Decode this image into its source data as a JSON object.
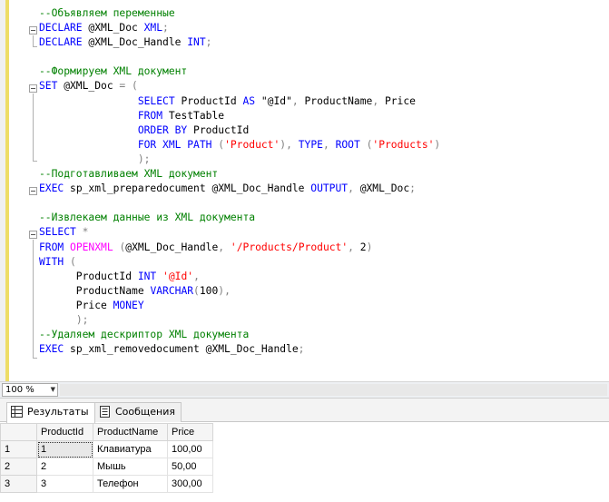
{
  "editor": {
    "lines": [
      [
        {
          "t": "--Объявляем переменные",
          "c": "cm"
        }
      ],
      [
        {
          "t": "DECLARE",
          "c": "kw"
        },
        {
          "t": " @XML_Doc "
        },
        {
          "t": "XML",
          "c": "kw"
        },
        {
          "t": ";",
          "c": "gr"
        }
      ],
      [
        {
          "t": "DECLARE",
          "c": "kw"
        },
        {
          "t": " @XML_Doc_Handle "
        },
        {
          "t": "INT",
          "c": "kw"
        },
        {
          "t": ";",
          "c": "gr"
        }
      ],
      [],
      [
        {
          "t": "--Формируем XML документ",
          "c": "cm"
        }
      ],
      [
        {
          "t": "SET",
          "c": "kw"
        },
        {
          "t": " @XML_Doc "
        },
        {
          "t": "=",
          "c": "gr"
        },
        {
          "t": " "
        },
        {
          "t": "(",
          "c": "gr"
        }
      ],
      [
        {
          "t": "                "
        },
        {
          "t": "SELECT",
          "c": "kw"
        },
        {
          "t": " ProductId "
        },
        {
          "t": "AS",
          "c": "kw"
        },
        {
          "t": " \"@Id\""
        },
        {
          "t": ",",
          "c": "gr"
        },
        {
          "t": " ProductName"
        },
        {
          "t": ",",
          "c": "gr"
        },
        {
          "t": " Price"
        }
      ],
      [
        {
          "t": "                "
        },
        {
          "t": "FROM",
          "c": "kw"
        },
        {
          "t": " TestTable"
        }
      ],
      [
        {
          "t": "                "
        },
        {
          "t": "ORDER BY",
          "c": "kw"
        },
        {
          "t": " ProductId"
        }
      ],
      [
        {
          "t": "                "
        },
        {
          "t": "FOR XML PATH",
          "c": "kw"
        },
        {
          "t": " "
        },
        {
          "t": "(",
          "c": "gr"
        },
        {
          "t": "'Product'",
          "c": "st"
        },
        {
          "t": "),",
          "c": "gr"
        },
        {
          "t": " "
        },
        {
          "t": "TYPE",
          "c": "kw"
        },
        {
          "t": ",",
          "c": "gr"
        },
        {
          "t": " "
        },
        {
          "t": "ROOT",
          "c": "kw"
        },
        {
          "t": " "
        },
        {
          "t": "(",
          "c": "gr"
        },
        {
          "t": "'Products'",
          "c": "st"
        },
        {
          "t": ")",
          "c": "gr"
        }
      ],
      [
        {
          "t": "                "
        },
        {
          "t": ");",
          "c": "gr"
        }
      ],
      [
        {
          "t": "--Подготавливаем XML документ",
          "c": "cm"
        }
      ],
      [
        {
          "t": "EXEC",
          "c": "kw"
        },
        {
          "t": " sp_xml_preparedocument @XML_Doc_Handle "
        },
        {
          "t": "OUTPUT",
          "c": "kw"
        },
        {
          "t": ",",
          "c": "gr"
        },
        {
          "t": " @XML_Doc"
        },
        {
          "t": ";",
          "c": "gr"
        }
      ],
      [],
      [
        {
          "t": "--Извлекаем данные из XML документа",
          "c": "cm"
        }
      ],
      [
        {
          "t": "SELECT",
          "c": "kw"
        },
        {
          "t": " "
        },
        {
          "t": "*",
          "c": "gr"
        }
      ],
      [
        {
          "t": "FROM",
          "c": "kw"
        },
        {
          "t": " "
        },
        {
          "t": "OPENXML",
          "c": "pi"
        },
        {
          "t": " "
        },
        {
          "t": "(",
          "c": "gr"
        },
        {
          "t": "@XML_Doc_Handle"
        },
        {
          "t": ",",
          "c": "gr"
        },
        {
          "t": " "
        },
        {
          "t": "'/Products/Product'",
          "c": "st"
        },
        {
          "t": ",",
          "c": "gr"
        },
        {
          "t": " 2"
        },
        {
          "t": ")",
          "c": "gr"
        }
      ],
      [
        {
          "t": "WITH",
          "c": "kw"
        },
        {
          "t": " "
        },
        {
          "t": "(",
          "c": "gr"
        }
      ],
      [
        {
          "t": "      ProductId "
        },
        {
          "t": "INT",
          "c": "kw"
        },
        {
          "t": " "
        },
        {
          "t": "'@Id'",
          "c": "st"
        },
        {
          "t": ",",
          "c": "gr"
        }
      ],
      [
        {
          "t": "      ProductName "
        },
        {
          "t": "VARCHAR",
          "c": "kw"
        },
        {
          "t": "(",
          "c": "gr"
        },
        {
          "t": "100"
        },
        {
          "t": "),",
          "c": "gr"
        }
      ],
      [
        {
          "t": "      Price "
        },
        {
          "t": "MONEY",
          "c": "kw"
        }
      ],
      [
        {
          "t": "      "
        },
        {
          "t": ");",
          "c": "gr"
        }
      ],
      [
        {
          "t": "--Удаляем дескриптор XML документа",
          "c": "cm"
        }
      ],
      [
        {
          "t": "EXEC",
          "c": "kw"
        },
        {
          "t": " sp_xml_removedocument @XML_Doc_Handle"
        },
        {
          "t": ";",
          "c": "gr"
        }
      ]
    ]
  },
  "zoom": {
    "value": "100 %"
  },
  "tabs": {
    "results": "Результаты",
    "messages": "Сообщения"
  },
  "grid": {
    "headers": [
      "",
      "ProductId",
      "ProductName",
      "Price"
    ],
    "rows": [
      [
        "1",
        "1",
        "Клавиатура",
        "100,00"
      ],
      [
        "2",
        "2",
        "Мышь",
        "50,00"
      ],
      [
        "3",
        "3",
        "Телефон",
        "300,00"
      ]
    ]
  },
  "colors": {
    "keyword": "#0000ff",
    "comment": "#008000",
    "string": "#ff0000",
    "operator": "#808080",
    "function": "#ff00ff",
    "change_marker": "#eedd66"
  }
}
